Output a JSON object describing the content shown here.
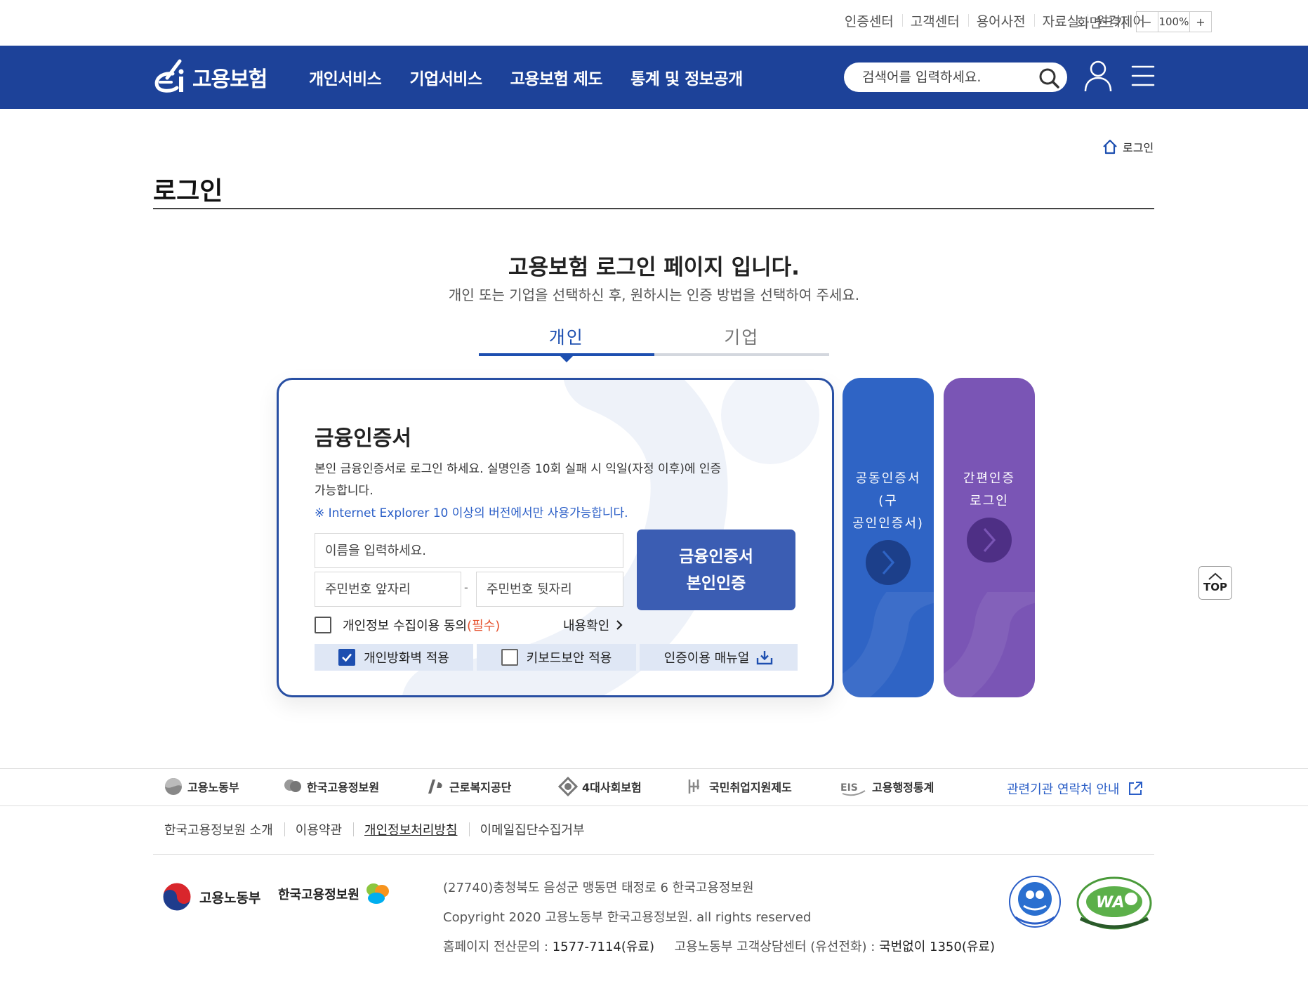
{
  "util": {
    "links": [
      "인증센터",
      "고객센터",
      "용어사전",
      "자료실",
      "원격제어"
    ],
    "fontsize_label": "화면크기",
    "minus": "−",
    "zoom": "100%",
    "plus": "+"
  },
  "header": {
    "logo_text": "고용보험",
    "gnb": [
      "개인서비스",
      "기업서비스",
      "고용보험 제도",
      "통계 및 정보공개"
    ],
    "search_placeholder": "검색어를 입력하세요.",
    "brand_color": "#1d4299"
  },
  "breadcrumb": {
    "current": "로그인"
  },
  "page": {
    "title": "로그인",
    "intro_title": "고용보험 로그인 페이지 입니다.",
    "intro_sub": "개인 또는 기업을 선택하신 후, 원하시는 인증 방법을 선택하여 주세요."
  },
  "tabs": [
    {
      "label": "개인",
      "active": true
    },
    {
      "label": "기업",
      "active": false
    }
  ],
  "cert": {
    "title": "금융인증서",
    "desc": "본인 금융인증서로 로그인 하세요. 실명인증 10회 실패 시 익일(자정 이후)에 인증가능합니다.",
    "note": "※ Internet Explorer 10 이상의 버전에서만 사용가능합니다.",
    "name_placeholder": "이름을 입력하세요.",
    "ssn_front_placeholder": "주민번호 앞자리",
    "ssn_back_placeholder": "주민번호 뒷자리",
    "dash": "-",
    "button_line1": "금융인증서",
    "button_line2": "본인인증",
    "agree_label": "개인정보 수집이용 동의",
    "agree_required": "(필수)",
    "view_link": "내용확인",
    "opt_firewall": "개인방화벽 적용",
    "opt_firewall_checked": true,
    "opt_keyboard": "키보드보안 적용",
    "opt_keyboard_checked": false,
    "opt_manual": "인증이용 매뉴얼"
  },
  "side": {
    "joint_label_1": "공동인증서",
    "joint_label_2": "(구",
    "joint_label_3": "공인인증서)",
    "simple_label_1": "간편인증",
    "simple_label_2": "로그인"
  },
  "top_button": "TOP",
  "footer": {
    "family": [
      "고용노동부",
      "한국고용정보원",
      "근로복지공단",
      "4대사회보험",
      "국민취업지원제도",
      "고용행정통계"
    ],
    "family_link": "관련기관 연락처 안내",
    "links": [
      "한국고용정보원 소개",
      "이용약관",
      "개인정보처리방침",
      "이메일집단수집거부"
    ],
    "logo1": "고용노동부",
    "logo2": "한국고용정보원",
    "address": "(27740)충청북도 음성군 맹동면 태정로 6 한국고용정보원",
    "copyright": "Copyright 2020 고용노동부 한국고용정보원. all rights reserved",
    "contact_prefix": "홈페이지 전산문의 :",
    "contact_number": "1577-7114(유료)",
    "center_prefix": "고용노동부 고객상담센터 (유선전화) :",
    "center_number": "국번없이 1350(유료)"
  }
}
